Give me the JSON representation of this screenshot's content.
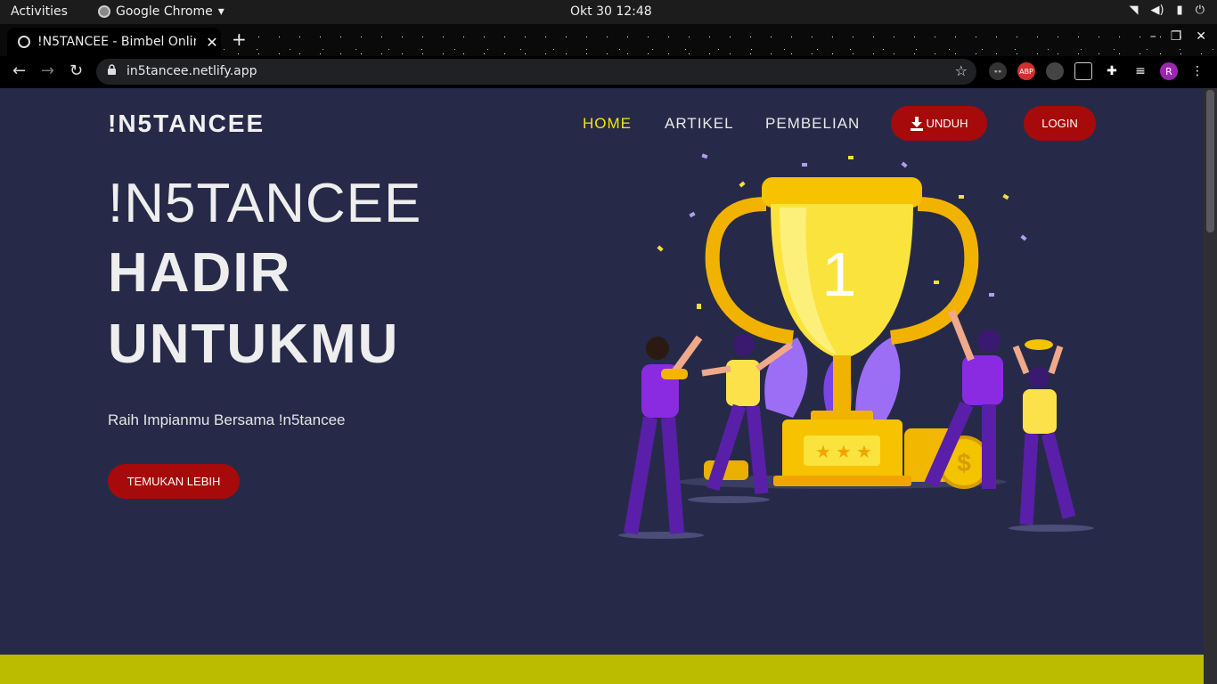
{
  "os": {
    "activities": "Activities",
    "app_name": "Google Chrome",
    "app_caret": "▾",
    "clock": "Okt 30  12:48",
    "system_icons": [
      "wifi-icon",
      "volume-icon",
      "battery-icon",
      "power-icon"
    ]
  },
  "browser": {
    "tab_title": "!N5TANCEE - Bimbel Onlin",
    "tab_close": "✕",
    "new_tab": "+",
    "window_controls": [
      "–",
      "❐",
      "✕"
    ],
    "url": "in5tancee.netlify.app",
    "nav": {
      "back": "←",
      "forward": "→",
      "reload": "↻",
      "lock": "🔒",
      "star": "☆"
    },
    "extensions": {
      "abp": "ABP",
      "avatar": "R"
    }
  },
  "site": {
    "brand": "!N5TANCEE",
    "menu": {
      "home": "HOME",
      "artikel": "ARTIKEL",
      "pembelian": "PEMBELIAN",
      "unduh": "UNDUH",
      "unduh_icon": "download-icon",
      "login": "LOGIN"
    },
    "hero": {
      "line1": "!N5TANCEE",
      "line2": "HADIR",
      "line3": "UNTUKMU",
      "tagline": "Raih Impianmu Bersama !n5tancee",
      "cta": "TEMUKAN LEBIH"
    },
    "illustration": {
      "trophy_number": "1",
      "subject": "trophy-celebration-illustration"
    },
    "colors": {
      "background": "#262a48",
      "active_link": "#f3e315",
      "button": "#a70a0a",
      "band": "#bbbc00"
    }
  }
}
